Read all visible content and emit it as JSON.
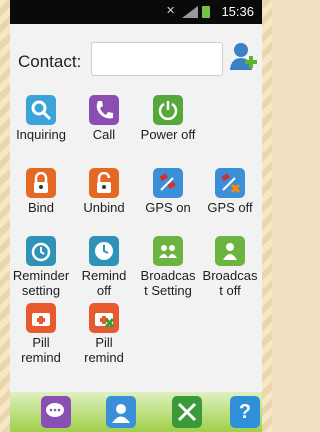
{
  "statusbar": {
    "time": "15:36"
  },
  "contact": {
    "label": "Contact:",
    "value": ""
  },
  "tiles": [
    {
      "label": "Inquiring",
      "color": "#3aa3d8",
      "icon": "search-icon"
    },
    {
      "label": "Call",
      "color": "#8a4fb3",
      "icon": "phone-icon"
    },
    {
      "label": "Power off",
      "color": "#57a83a",
      "icon": "power-icon"
    },
    {
      "label": "Bind",
      "color": "#e46a24",
      "icon": "lock-closed-icon"
    },
    {
      "label": "Unbind",
      "color": "#e46a24",
      "icon": "lock-open-icon"
    },
    {
      "label": "GPS on",
      "color": "#3b8fd8",
      "icon": "satellite-icon"
    },
    {
      "label": "GPS off",
      "color": "#3b8fd8",
      "icon": "satellite-off-icon"
    },
    {
      "label": "Reminder\nsetting",
      "color": "#2f93b8",
      "icon": "alarm-clock-icon"
    },
    {
      "label": "Remind\noff",
      "color": "#2f93b8",
      "icon": "clock-off-icon"
    },
    {
      "label": "Broadcas\nt Setting",
      "color": "#6db33f",
      "icon": "group-icon"
    },
    {
      "label": "Broadcas\nt off",
      "color": "#6db33f",
      "icon": "person-icon"
    },
    {
      "label": "Pill\nremind",
      "color": "#e65a2e",
      "icon": "medkit-icon"
    },
    {
      "label": "Pill\nremind",
      "color": "#e65a2e",
      "icon": "medkit-off-icon"
    }
  ],
  "dock": [
    {
      "icon": "chat-icon",
      "color": "#8a4fb3"
    },
    {
      "icon": "contacts-icon",
      "color": "#3a8fd8"
    },
    {
      "icon": "tools-icon",
      "color": "#3a9a3a"
    },
    {
      "icon": "help-icon",
      "color": "#2f90d8",
      "glyph": "?"
    }
  ]
}
